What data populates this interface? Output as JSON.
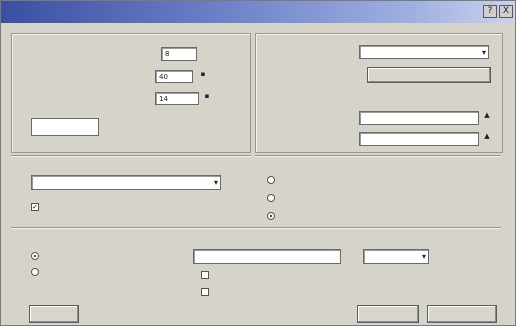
{
  "window": {
    "title": "",
    "title_buttons": [
      "?",
      "X"
    ]
  },
  "left_panel": {
    "group1_label": "",
    "rows": [
      {
        "label": "",
        "value": "8"
      },
      {
        "label": "",
        "value": "40"
      },
      {
        "label": "",
        "value": "14"
      }
    ],
    "swatch_label_line1": "",
    "swatch_label_line2": ""
  },
  "right_panel": {
    "group_label": "",
    "top_label": "",
    "top_dropdown": "",
    "top_button": "",
    "sub_label": "",
    "row1_label": "",
    "row1_value": "",
    "row2_label": "",
    "row2_value": ""
  },
  "mid_left": {
    "group_label": "",
    "dropdown_value": "",
    "checkbox_label": ""
  },
  "mid_right": {
    "group_label": "",
    "radio1_label": "",
    "radio2_label": "",
    "radio3_label": ""
  },
  "bottom": {
    "col1_label": "",
    "col1_item1": "",
    "col1_item2": "",
    "col2_label": "",
    "col2_field": "",
    "col2_check1": "",
    "col2_check2": "",
    "col3_label": "",
    "col3_dropdown": ""
  },
  "footer": {
    "left_button": "",
    "right_button1": "",
    "right_button2": ""
  }
}
